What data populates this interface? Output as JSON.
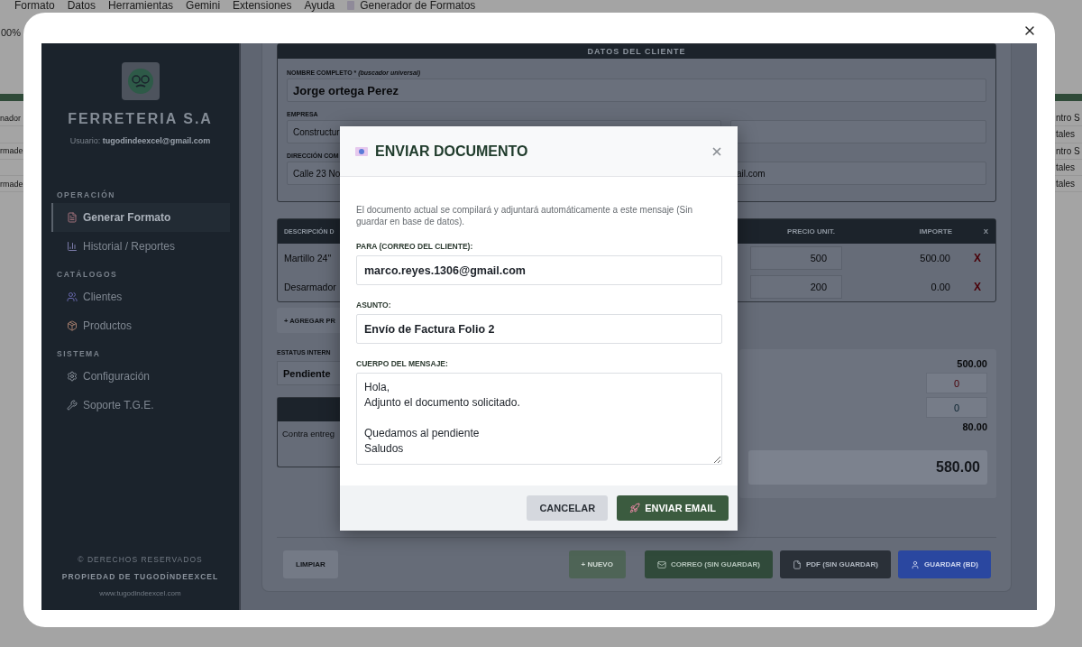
{
  "sheet": {
    "menu": [
      "Formato",
      "Datos",
      "Herramientas",
      "Gemini",
      "Extensiones",
      "Ayuda",
      "Generador de Formatos"
    ],
    "zoom": "00%",
    "rows": [
      {
        "left": "nador",
        "right": "ntro S"
      },
      {
        "right": "tales"
      },
      {
        "left": "rmade",
        "right": "ntro S"
      },
      {
        "right": "tales"
      },
      {
        "left": "rmade",
        "right": "tales"
      }
    ]
  },
  "sidebar": {
    "brand": "FERRETERIA S.A",
    "user_label": "Usuario:",
    "user_email": "tugodindeexcel@gmail.com",
    "sections": [
      {
        "title": "OPERACIÓN",
        "items": [
          {
            "label": "Generar Formato",
            "selected": true
          },
          {
            "label": "Historial / Reportes",
            "selected": false
          }
        ]
      },
      {
        "title": "CATÁLOGOS",
        "items": [
          {
            "label": "Clientes",
            "selected": false
          },
          {
            "label": "Productos",
            "selected": false
          }
        ]
      },
      {
        "title": "SISTEMA",
        "items": [
          {
            "label": "Configuración",
            "selected": false
          },
          {
            "label": "Soporte T.G.E.",
            "selected": false
          }
        ]
      }
    ],
    "footer": [
      "© DERECHOS RESERVADOS",
      "PROPIEDAD DE TUGODÍNDEEXCEL",
      "www.tugodindeexcel.com"
    ]
  },
  "client_panel": {
    "title": "DATOS DEL CLIENTE",
    "fields": [
      {
        "label": "NOMBRE COMPLETO * *(buscador universal)*",
        "value": "Jorge ortega Perez"
      },
      {
        "label": "EMPRESA",
        "value": "Constructur"
      },
      {
        "label": "DIRECCIÓN COM",
        "value": "Calle 23 No"
      },
      {
        "value": "ail.com"
      }
    ]
  },
  "items_table": {
    "columns": [
      "DESCRIPCIÓN D",
      "PRECIO UNIT.",
      "IMPORTE",
      "X"
    ],
    "rows": [
      {
        "description": "Martillo 24\"",
        "price": "500",
        "amount": "500.00",
        "remove": "X"
      },
      {
        "description": "Desarmador",
        "price": "200",
        "amount": "0.00",
        "remove": "X"
      }
    ]
  },
  "add_button": "+ AGREGAR PR",
  "status": {
    "label": "ESTATUS INTERN",
    "value": "Pendiente"
  },
  "notes": {
    "value": "Contra entreg"
  },
  "totals": {
    "subtotal": "500.00",
    "discount": "0",
    "tax_rate": "0",
    "tax": "80.00",
    "total": "580.00"
  },
  "actions": [
    {
      "label": "LIMPIAR",
      "kind": "clear"
    },
    {
      "label": "+ NUEVO",
      "kind": "new"
    },
    {
      "label": "CORREO (SIN GUARDAR)",
      "kind": "email"
    },
    {
      "label": "PDF (SIN GUARDAR)",
      "kind": "pdf"
    },
    {
      "label": "GUARDAR (BD)",
      "kind": "save"
    }
  ],
  "modal": {
    "title": "ENVIAR DOCUMENTO",
    "description": "El documento actual se compilará y adjuntará automáticamente a este mensaje (Sin guardar en base de datos).",
    "fields": [
      {
        "label": "PARA (CORREO DEL CLIENTE):",
        "value": "marco.reyes.1306@gmail.com",
        "kind": "input"
      },
      {
        "label": "ASUNTO:",
        "value": "Envío de Factura Folio 2",
        "kind": "input"
      },
      {
        "label": "CUERPO DEL MENSAJE:",
        "value": "Hola,\nAdjunto el documento solicitado.\n\nQuedamos al pendiente\nSaludos",
        "kind": "textarea"
      }
    ],
    "buttons": [
      {
        "label": "CANCELAR",
        "kind": "secondary"
      },
      {
        "label": "ENVIAR EMAIL",
        "kind": "primary"
      }
    ]
  }
}
